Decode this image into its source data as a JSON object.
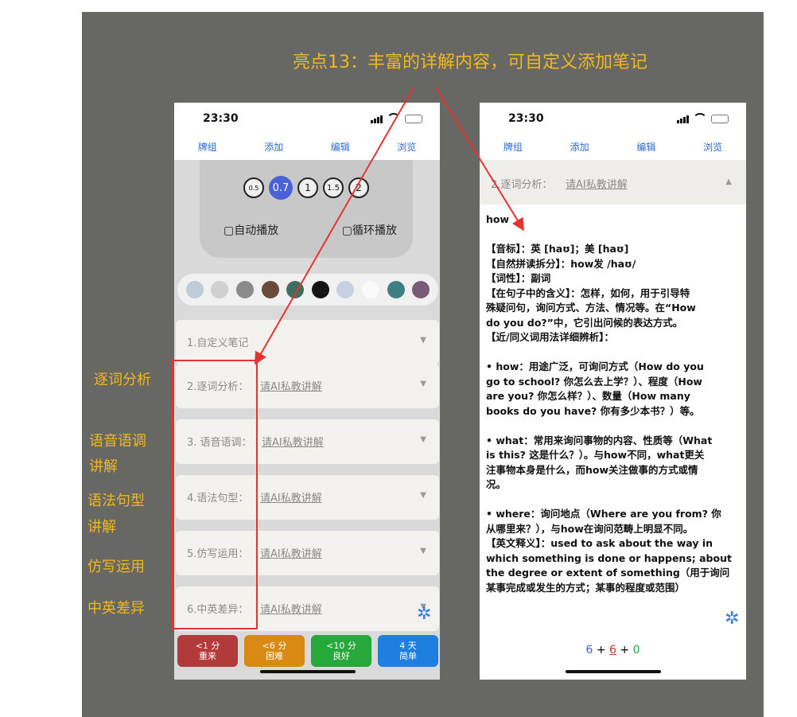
{
  "headline": "亮点13：丰富的详解内容，可自定义添加笔记",
  "status_time": "23:30",
  "nav_items": [
    "牌组",
    "添加",
    "编辑",
    "浏览"
  ],
  "speeds": [
    "0.5",
    "0.7",
    "1",
    "1.5",
    "2"
  ],
  "auto_play": "自动播放",
  "loop_play": "循环播放",
  "swatch_colors": [
    "#bfcbd6",
    "#d0d0d0",
    "#8a8a8a",
    "#6b4a3c",
    "#3d6e5f",
    "#141414",
    "#c7d0e2",
    "#fafafa",
    "#3f7e84",
    "#7a5a74"
  ],
  "sections": [
    {
      "label": "1.自定义笔记",
      "link": ""
    },
    {
      "label": "2.逐词分析：",
      "link": "请AI私教讲解"
    },
    {
      "label": "3. 语音语调：",
      "link": "请AI私教讲解"
    },
    {
      "label": "4.语法句型：",
      "link": "请AI私教讲解"
    },
    {
      "label": "5.仿写运用：",
      "link": "请AI私教讲解"
    },
    {
      "label": "6.中英差异：",
      "link": "请AI私教讲解"
    }
  ],
  "answer_buttons": [
    {
      "time": "<1 分",
      "label": "重来",
      "color": "#b33a3a"
    },
    {
      "time": "<6 分",
      "label": "困难",
      "color": "#d98a13"
    },
    {
      "time": "<10 分",
      "label": "良好",
      "color": "#26a83a"
    },
    {
      "time": "4 天",
      "label": "简单",
      "color": "#1f7fe0"
    }
  ],
  "side_labels": [
    "逐词分析",
    "语音语调",
    "讲解",
    "语法句型",
    "讲解",
    "仿写运用",
    "中英差异"
  ],
  "right": {
    "section_title": "2.逐词分析：",
    "section_link": "请AI私教讲解",
    "content_lines": [
      "how",
      "",
      "【音标】：英 [haʊ]；美 [haʊ]",
      "【自然拼读拆分】：how发 /haʊ/",
      "【词性】：副词",
      "【在句子中的含义】：怎样，如何，用于引导特",
      "殊疑问句，询问方式、方法、情况等。在“How",
      "do you do?”中，它引出问候的表达方式。",
      "【近/同义词用法详细辨析】：",
      "",
      "• how：用途广泛，可询问方式（How do you",
      "go to school? 你怎么去上学？）、程度（How",
      "are you? 你怎么样？）、数量（How many",
      "books do you have? 你有多少本书？）等。",
      "",
      "• what：常用来询问事物的内容、性质等（What",
      "is this? 这是什么？）。与how不同，what更关",
      "注事物本身是什么，而how关注做事的方式或情",
      "况。",
      "",
      "• where：询问地点（Where are you from? 你",
      "从哪里来？），与how在询问范畴上明显不同。",
      "【英文释义】：used to ask about the way in",
      "which something is done or happens; about",
      "the degree or extent of something（用于询问",
      "某事完成或发生的方式；某事的程度或范围）"
    ],
    "counter_new": "6",
    "counter_learn": "6",
    "counter_review": "0"
  }
}
